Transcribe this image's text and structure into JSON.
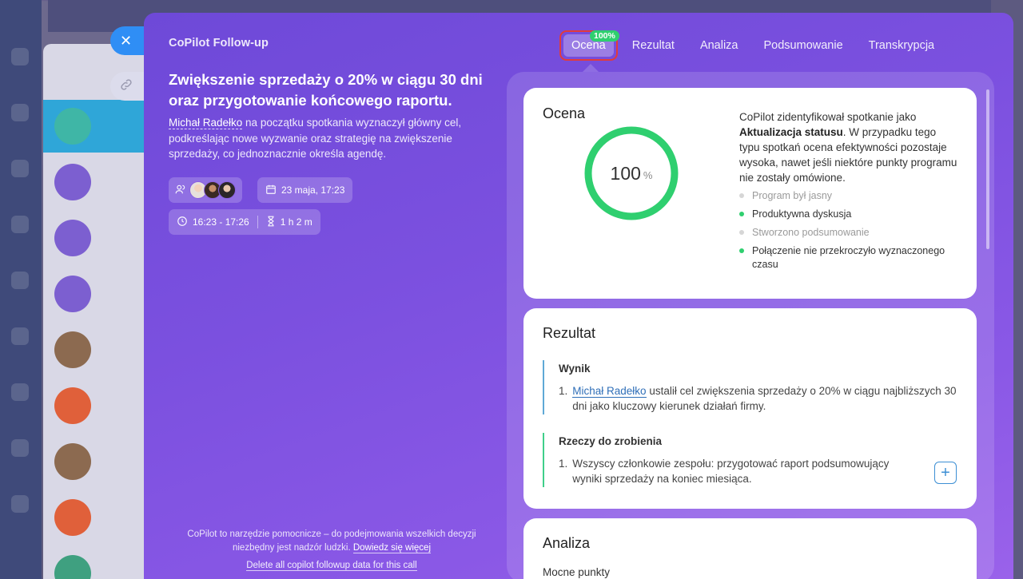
{
  "panel": {
    "title": "CoPilot Follow-up"
  },
  "meeting": {
    "title": "Zwiększenie sprzedaży o 20% w ciągu 30 dni oraz przygotowanie końcowego raportu.",
    "person": "Michał Radełko",
    "desc_rest": " na początku spotkania wyznaczył główny cel, podkreślając nowe wyzwanie oraz strategię na zwiększenie sprzedaży, co jednoznacznie określa agendę.",
    "date": "23 maja, 17:23",
    "time_range": "16:23 - 17:26",
    "duration": "1 h 2 m"
  },
  "footer": {
    "note": "CoPilot to narzędzie pomocnicze – do podejmowania wszelkich decyzji niezbędny jest nadzór ludzki.",
    "more_link": "Dowiedz się więcej",
    "delete_link": "Delete all copilot followup data for this call"
  },
  "tabs": {
    "badge": "100%",
    "items": [
      "Ocena",
      "Rezultat",
      "Analiza",
      "Podsumowanie",
      "Transkrypcja"
    ]
  },
  "ocena": {
    "title": "Ocena",
    "score": 100,
    "score_unit": "%",
    "text_pre": "CoPilot zidentyfikował spotkanie jako ",
    "text_bold": "Aktualizacja statusu",
    "text_post": ". W przypadku tego typu spotkań ocena efektywności pozostaje wysoka, nawet jeśli niektóre punkty programu nie zostały omówione.",
    "criteria": [
      {
        "label": "Program był jasny",
        "met": false
      },
      {
        "label": "Produktywna dyskusja",
        "met": true
      },
      {
        "label": "Stworzono podsumowanie",
        "met": false
      },
      {
        "label": "Połączenie nie przekroczyło wyznaczonego czasu",
        "met": true
      }
    ]
  },
  "rezultat": {
    "title": "Rezultat",
    "wynik_title": "Wynik",
    "wynik_num": "1.",
    "wynik_person": "Michał Radełko",
    "wynik_text": " ustalił cel zwiększenia sprzedaży o 20% w ciągu najbliższych 30 dni jako kluczowy kierunek działań firmy.",
    "todo_title": "Rzeczy do zrobienia",
    "todo_num": "1.",
    "todo_text": "Wszyscy członkowie zespołu: przygotować raport podsumowujący wyniki sprzedaży na koniec miesiąca.",
    "plus": "+"
  },
  "analiza": {
    "title": "Analiza",
    "subtitle": "Mocne punkty"
  },
  "icons": {
    "close": "close-icon",
    "link": "link-icon",
    "participants": "participants-icon",
    "calendar": "calendar-icon",
    "clock": "clock-icon",
    "hourglass": "hourglass-icon"
  },
  "colors": {
    "accent_green": "#2fcf6f",
    "highlight_red": "#e23b3b",
    "link_blue": "#2f6fb8",
    "close_blue": "#2f8ef5"
  }
}
